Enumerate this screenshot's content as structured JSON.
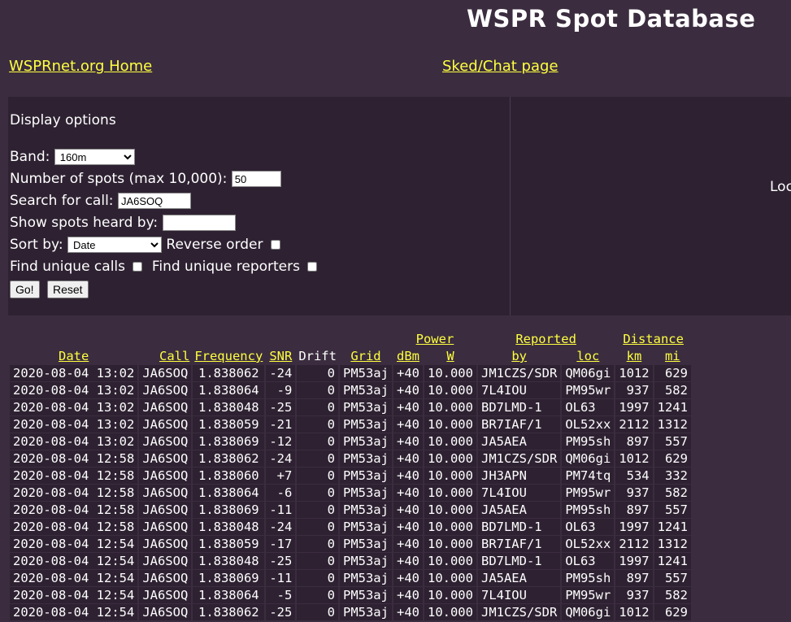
{
  "header": {
    "title": "WSPR Spot Database",
    "home_link": "WSPRnet.org Home",
    "sked_link": "Sked/Chat page"
  },
  "options": {
    "heading": "Display options",
    "band_label": "Band:",
    "band_value": "160m",
    "spots_label": "Number of spots (max 10,000):",
    "spots_value": "50",
    "call_label": "Search for call:",
    "call_value": "JA6SOQ",
    "heard_label": "Show spots heard by:",
    "heard_value": "",
    "sort_label": "Sort by:",
    "sort_value": "Date",
    "reverse_label": "Reverse order",
    "unique_calls_label": "Find unique calls",
    "unique_reporters_label": "Find unique reporters",
    "go_label": "Go!",
    "reset_label": "Reset",
    "side_label": "Loc"
  },
  "table": {
    "group_headers": {
      "power": "Power",
      "reported": "Reported",
      "distance": "Distance"
    },
    "headers": {
      "date": "Date",
      "call": "Call",
      "frequency": "Frequency",
      "snr": "SNR",
      "drift": "Drift",
      "grid": "Grid",
      "dbm": "dBm",
      "w": "W",
      "by": "by",
      "loc": "loc",
      "km": "km",
      "mi": "mi"
    },
    "rows": [
      [
        "2020-08-04 13:02",
        "JA6SOQ",
        "1.838062",
        "-24",
        "0",
        "PM53aj",
        "+40",
        "10.000",
        "JM1CZS/SDR",
        "QM06gi",
        "1012",
        "629"
      ],
      [
        "2020-08-04 13:02",
        "JA6SOQ",
        "1.838064",
        "-9",
        "0",
        "PM53aj",
        "+40",
        "10.000",
        "7L4IOU",
        "PM95wr",
        "937",
        "582"
      ],
      [
        "2020-08-04 13:02",
        "JA6SOQ",
        "1.838048",
        "-25",
        "0",
        "PM53aj",
        "+40",
        "10.000",
        "BD7LMD-1",
        "OL63",
        "1997",
        "1241"
      ],
      [
        "2020-08-04 13:02",
        "JA6SOQ",
        "1.838059",
        "-21",
        "0",
        "PM53aj",
        "+40",
        "10.000",
        "BR7IAF/1",
        "OL52xx",
        "2112",
        "1312"
      ],
      [
        "2020-08-04 13:02",
        "JA6SOQ",
        "1.838069",
        "-12",
        "0",
        "PM53aj",
        "+40",
        "10.000",
        "JA5AEA",
        "PM95sh",
        "897",
        "557"
      ],
      [
        "2020-08-04 12:58",
        "JA6SOQ",
        "1.838062",
        "-24",
        "0",
        "PM53aj",
        "+40",
        "10.000",
        "JM1CZS/SDR",
        "QM06gi",
        "1012",
        "629"
      ],
      [
        "2020-08-04 12:58",
        "JA6SOQ",
        "1.838060",
        "+7",
        "0",
        "PM53aj",
        "+40",
        "10.000",
        "JH3APN",
        "PM74tq",
        "534",
        "332"
      ],
      [
        "2020-08-04 12:58",
        "JA6SOQ",
        "1.838064",
        "-6",
        "0",
        "PM53aj",
        "+40",
        "10.000",
        "7L4IOU",
        "PM95wr",
        "937",
        "582"
      ],
      [
        "2020-08-04 12:58",
        "JA6SOQ",
        "1.838069",
        "-11",
        "0",
        "PM53aj",
        "+40",
        "10.000",
        "JA5AEA",
        "PM95sh",
        "897",
        "557"
      ],
      [
        "2020-08-04 12:58",
        "JA6SOQ",
        "1.838048",
        "-24",
        "0",
        "PM53aj",
        "+40",
        "10.000",
        "BD7LMD-1",
        "OL63",
        "1997",
        "1241"
      ],
      [
        "2020-08-04 12:54",
        "JA6SOQ",
        "1.838059",
        "-17",
        "0",
        "PM53aj",
        "+40",
        "10.000",
        "BR7IAF/1",
        "OL52xx",
        "2112",
        "1312"
      ],
      [
        "2020-08-04 12:54",
        "JA6SOQ",
        "1.838048",
        "-25",
        "0",
        "PM53aj",
        "+40",
        "10.000",
        "BD7LMD-1",
        "OL63",
        "1997",
        "1241"
      ],
      [
        "2020-08-04 12:54",
        "JA6SOQ",
        "1.838069",
        "-11",
        "0",
        "PM53aj",
        "+40",
        "10.000",
        "JA5AEA",
        "PM95sh",
        "897",
        "557"
      ],
      [
        "2020-08-04 12:54",
        "JA6SOQ",
        "1.838064",
        "-5",
        "0",
        "PM53aj",
        "+40",
        "10.000",
        "7L4IOU",
        "PM95wr",
        "937",
        "582"
      ],
      [
        "2020-08-04 12:54",
        "JA6SOQ",
        "1.838062",
        "-25",
        "0",
        "PM53aj",
        "+40",
        "10.000",
        "JM1CZS/SDR",
        "QM06gi",
        "1012",
        "629"
      ]
    ]
  }
}
